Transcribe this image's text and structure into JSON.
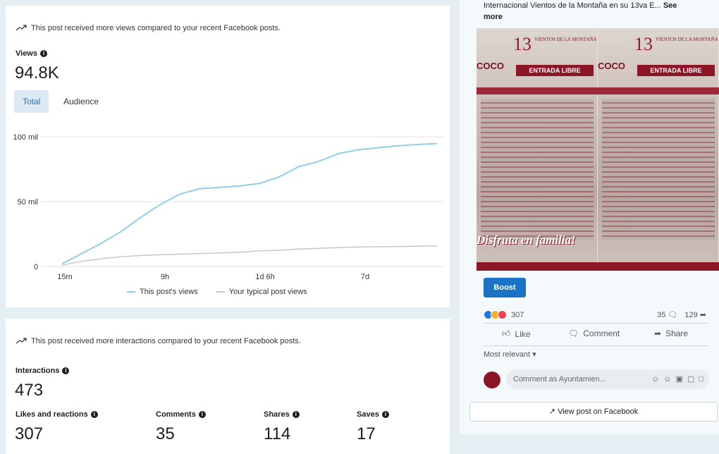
{
  "views_section": {
    "notice": "This post received more views compared to your recent Facebook posts.",
    "label": "Views",
    "value": "94.8K",
    "tabs": [
      "Total",
      "Audience"
    ],
    "legend": [
      "This post's views",
      "Your typical post views"
    ]
  },
  "chart_data": {
    "type": "line",
    "x_ticks": [
      "15m",
      "9h",
      "1d 6h",
      "7d"
    ],
    "y_ticks": [
      "100 mil",
      "50 mil",
      "0"
    ],
    "ylim": [
      0,
      100000
    ],
    "series": [
      {
        "name": "This post's views",
        "color": "#8fcfe8",
        "values": [
          2000,
          10000,
          18000,
          27000,
          38000,
          48000,
          56000,
          60000,
          61000,
          62000,
          64000,
          69000,
          77000,
          81000,
          87000,
          90000,
          91500,
          93000,
          94000,
          94800
        ]
      },
      {
        "name": "Your typical post views",
        "color": "#c8c8c8",
        "values": [
          1000,
          4000,
          6000,
          7500,
          8500,
          9000,
          9500,
          10000,
          10500,
          11000,
          12000,
          12500,
          13500,
          14000,
          14500,
          15000,
          15200,
          15400,
          15600,
          15800
        ]
      }
    ]
  },
  "interactions_section": {
    "notice": "This post received more interactions compared to your recent Facebook posts.",
    "label": "Interactions",
    "value": "473",
    "stats": [
      {
        "label": "Likes and reactions",
        "value": "307"
      },
      {
        "label": "Comments",
        "value": "35"
      },
      {
        "label": "Shares",
        "value": "114"
      },
      {
        "label": "Saves",
        "value": "17"
      }
    ]
  },
  "post": {
    "caption": "Internacional Vientos de la Montaña en su 13va E...",
    "see_more": "See more",
    "poster": {
      "logo": "13",
      "festival": "VIENTOS DE LA MONTAÑA",
      "brand": "COCO",
      "banner": "ENTRADA LIBRE",
      "family": "Disfruta en familia!"
    },
    "boost_label": "Boost",
    "reaction_count": "307",
    "comment_count": "35",
    "share_count": "129",
    "actions": [
      "Like",
      "Comment",
      "Share"
    ],
    "most_relevant": "Most relevant",
    "comment_placeholder": "Comment as Ayuntamien...",
    "view_on_facebook": "View post on Facebook"
  },
  "colors": {
    "accent": "#1a73c5",
    "series_primary": "#8fcfe8",
    "series_typical": "#c8c8c8"
  }
}
